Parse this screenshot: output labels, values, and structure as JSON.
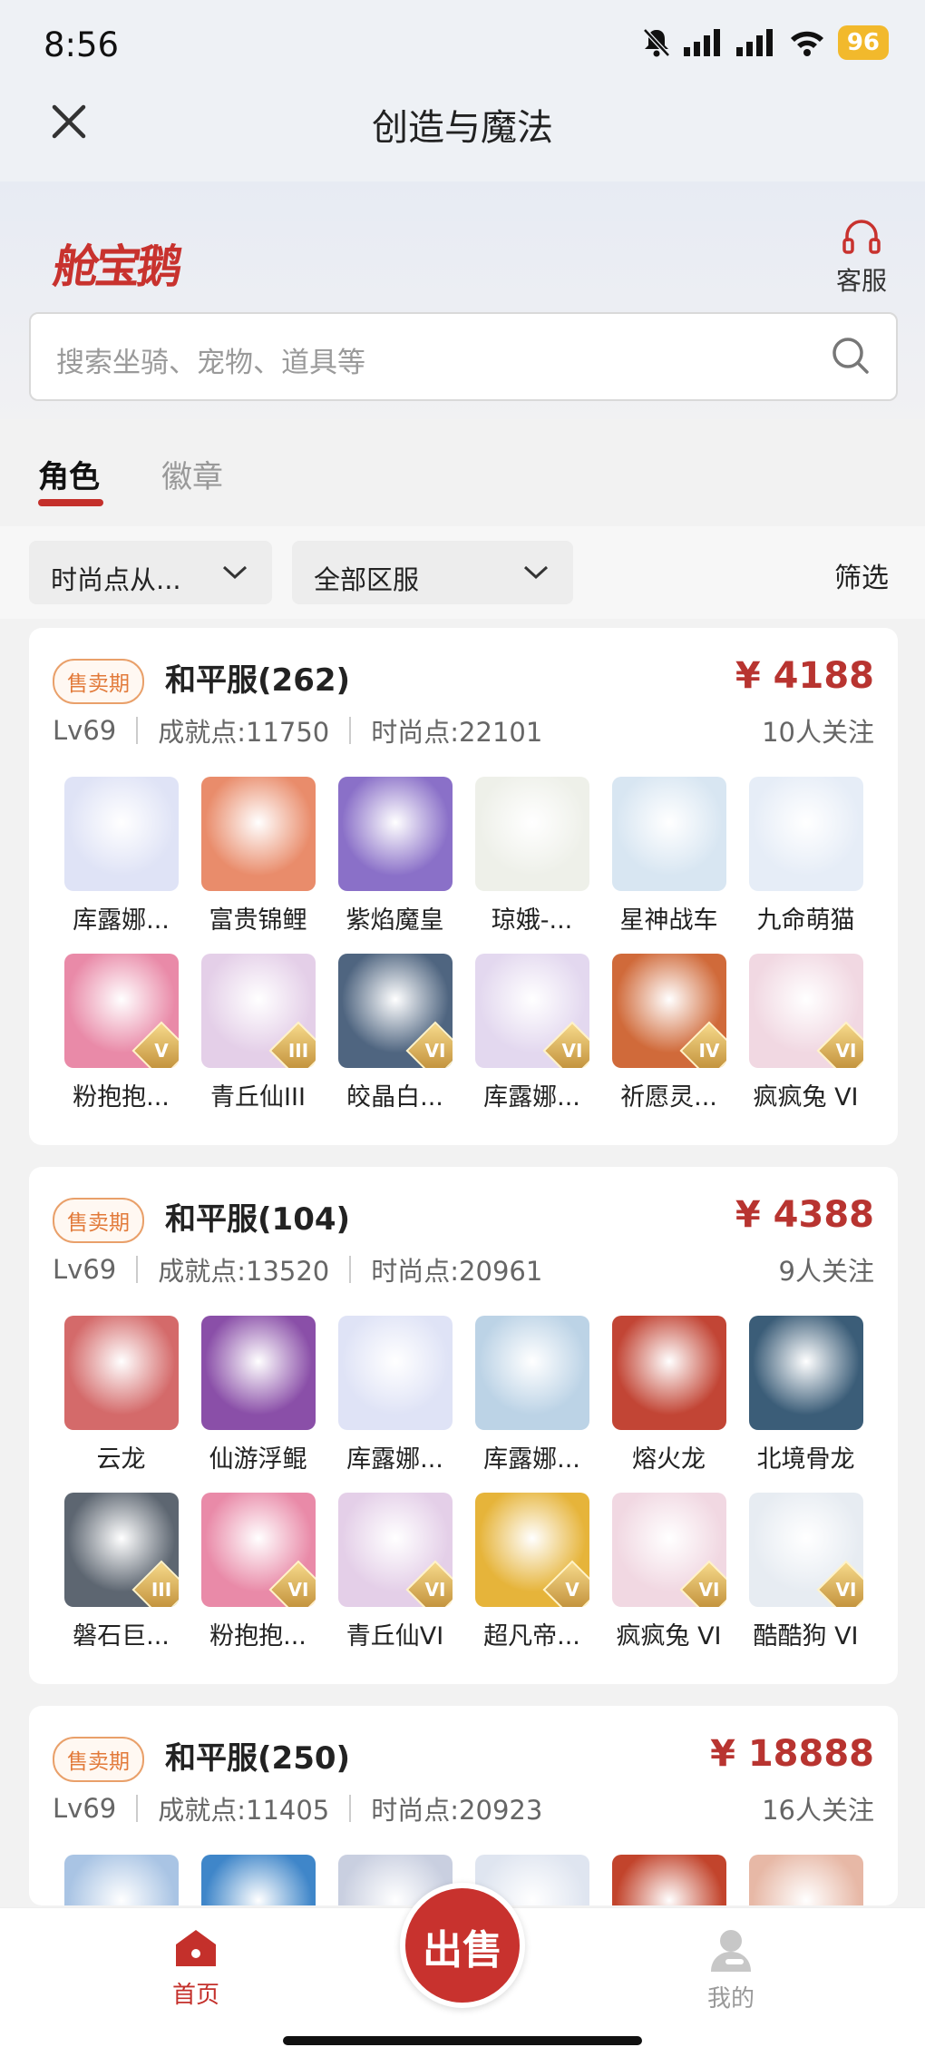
{
  "status_bar": {
    "time": "8:56",
    "battery": "96"
  },
  "nav": {
    "title": "创造与魔法",
    "close_icon": "close-icon"
  },
  "brand": {
    "logo": "舱宝鹅",
    "service_label": "客服"
  },
  "search": {
    "placeholder": "搜索坐骑、宠物、道具等"
  },
  "tabs": [
    {
      "label": "角色",
      "active": true
    },
    {
      "label": "徽章",
      "active": false
    }
  ],
  "filters": {
    "fashion": "时尚点从...",
    "server": "全部区服",
    "screen": "筛选"
  },
  "listings": [
    {
      "badge": "售卖期",
      "server": "和平服(262)",
      "price": "¥ 4188",
      "level": "Lv69",
      "achievement": "成就点:11750",
      "fashion": "时尚点:22101",
      "followers": "10人关注",
      "items": [
        {
          "name": "库露娜...",
          "tier": "",
          "color": "#dfe3f6"
        },
        {
          "name": "富贵锦鲤",
          "tier": "",
          "color": "#e98c6b"
        },
        {
          "name": "紫焰魔皇",
          "tier": "",
          "color": "#8a70c8"
        },
        {
          "name": "琼娥-...",
          "tier": "",
          "color": "#eef0e9"
        },
        {
          "name": "星神战车",
          "tier": "",
          "color": "#d8e6f2"
        },
        {
          "name": "九命萌猫",
          "tier": "",
          "color": "#e6edf7"
        },
        {
          "name": "粉抱抱...",
          "tier": "V",
          "color": "#e98aa8"
        },
        {
          "name": "青丘仙III",
          "tier": "III",
          "color": "#e4cfe8"
        },
        {
          "name": "皎晶白...",
          "tier": "VI",
          "color": "#4f6580"
        },
        {
          "name": "库露娜...",
          "tier": "VI",
          "color": "#e3d8ef"
        },
        {
          "name": "祈愿灵...",
          "tier": "IV",
          "color": "#d06a3a"
        },
        {
          "name": "疯疯兔 VI",
          "tier": "VI",
          "color": "#f1d8e2"
        }
      ]
    },
    {
      "badge": "售卖期",
      "server": "和平服(104)",
      "price": "¥ 4388",
      "level": "Lv69",
      "achievement": "成就点:13520",
      "fashion": "时尚点:20961",
      "followers": "9人关注",
      "items": [
        {
          "name": "云龙",
          "tier": "",
          "color": "#d46a6a"
        },
        {
          "name": "仙游浮鲲",
          "tier": "",
          "color": "#8a4fa8"
        },
        {
          "name": "库露娜...",
          "tier": "",
          "color": "#dfe3f6"
        },
        {
          "name": "库露娜...",
          "tier": "",
          "color": "#bcd3e6"
        },
        {
          "name": "熔火龙",
          "tier": "",
          "color": "#c24535"
        },
        {
          "name": "北境骨龙",
          "tier": "",
          "color": "#3b5d78"
        },
        {
          "name": "磐石巨...",
          "tier": "III",
          "color": "#5d6671"
        },
        {
          "name": "粉抱抱...",
          "tier": "VI",
          "color": "#e98aa8"
        },
        {
          "name": "青丘仙VI",
          "tier": "VI",
          "color": "#e4cfe8"
        },
        {
          "name": "超凡帝...",
          "tier": "V",
          "color": "#e6b43a"
        },
        {
          "name": "疯疯兔 VI",
          "tier": "VI",
          "color": "#f1d8e2"
        },
        {
          "name": "酷酷狗 VI",
          "tier": "VI",
          "color": "#e7ecf2"
        }
      ]
    },
    {
      "badge": "售卖期",
      "server": "和平服(250)",
      "price": "¥ 18888",
      "level": "Lv69",
      "achievement": "成就点:11405",
      "fashion": "时尚点:20923",
      "followers": "16人关注",
      "items": [
        {
          "name": "",
          "tier": "",
          "color": "#a9c4e4"
        },
        {
          "name": "",
          "tier": "",
          "color": "#3f86c9"
        },
        {
          "name": "",
          "tier": "",
          "color": "#c9cfe0"
        },
        {
          "name": "",
          "tier": "",
          "color": "#dfe5f0"
        },
        {
          "name": "",
          "tier": "",
          "color": "#c2442c"
        },
        {
          "name": "",
          "tier": "",
          "color": "#e7b8a6"
        }
      ]
    }
  ],
  "bottom_nav": {
    "home": "首页",
    "sell": "出售",
    "mine": "我的"
  }
}
